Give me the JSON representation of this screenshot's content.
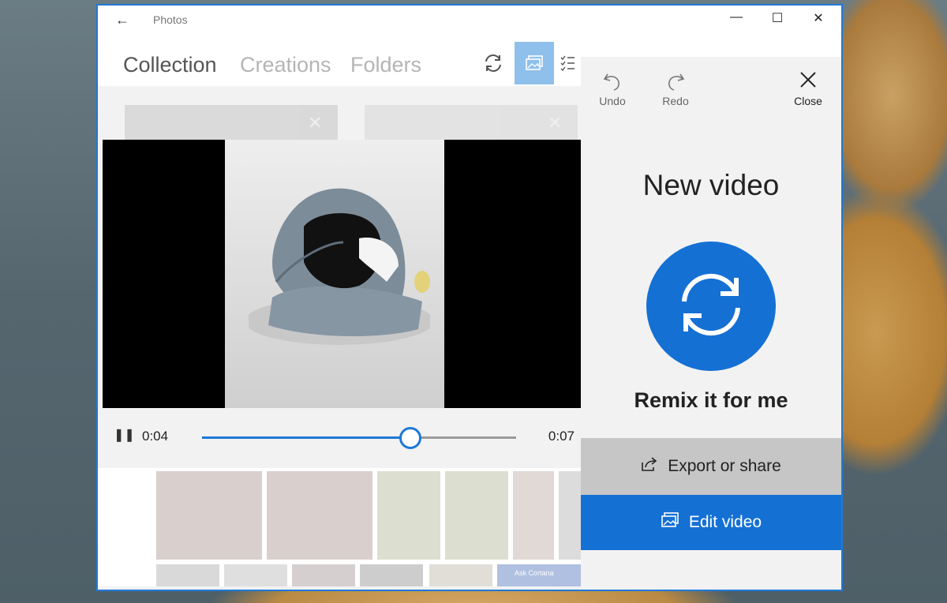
{
  "window": {
    "app_title": "Photos"
  },
  "nav": {
    "tabs": [
      "Collection",
      "Creations",
      "Folders"
    ],
    "active_tab": "Collection"
  },
  "player": {
    "current_time": "0:04",
    "end_time": "0:07",
    "progress": 0.66
  },
  "side_panel": {
    "undo_label": "Undo",
    "redo_label": "Redo",
    "close_label": "Close",
    "title": "New video",
    "remix_label": "Remix it for me",
    "export_label": "Export or share",
    "edit_label": "Edit video"
  },
  "background_thumbs": {
    "cortana_label": "Ask Cortana"
  },
  "colors": {
    "accent": "#1570d4",
    "window_border": "#1f7ad8",
    "selected_nav": "#8fc0ec"
  },
  "icons": [
    "back-arrow-icon",
    "minimize-icon",
    "maximize-icon",
    "close-window-icon",
    "sync-icon",
    "slideshow-icon",
    "select-icon",
    "undo-icon",
    "redo-icon",
    "close-icon",
    "remix-icon",
    "share-icon",
    "edit-video-icon",
    "pause-icon"
  ]
}
